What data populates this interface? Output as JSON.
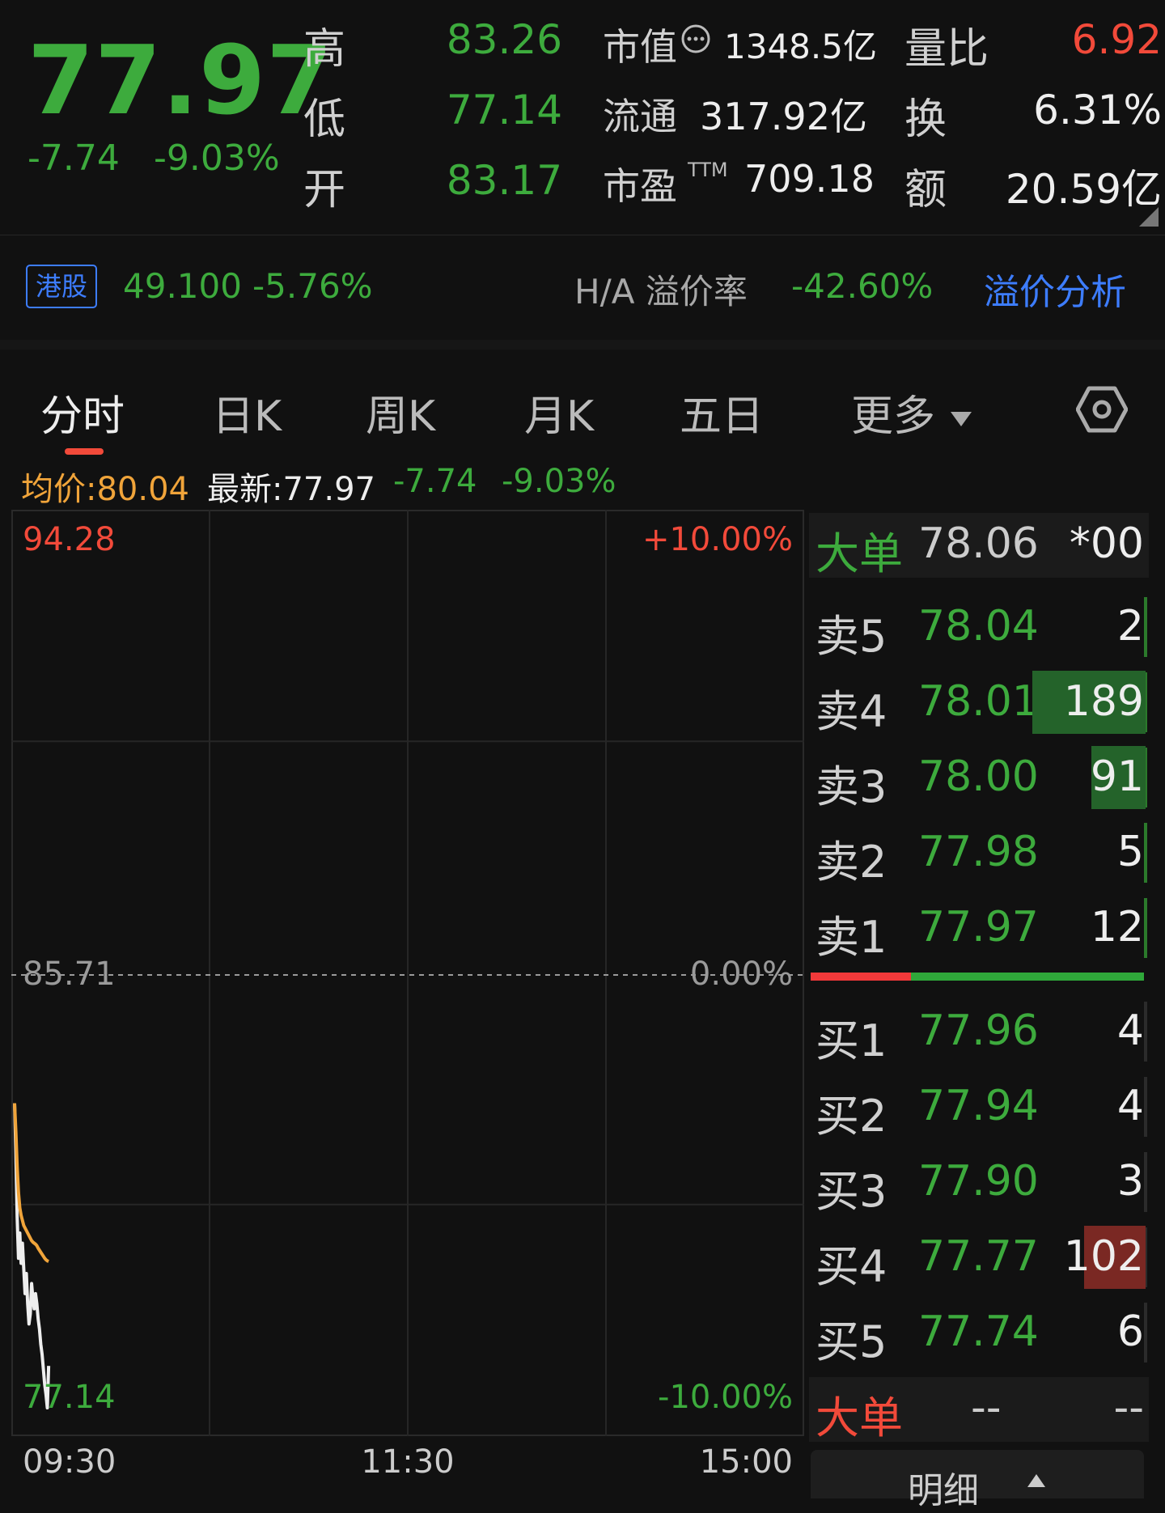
{
  "quote": {
    "price": "77.97",
    "change_abs": "-7.74",
    "change_pct": "-9.03%",
    "high_label": "高",
    "high": "83.26",
    "low_label": "低",
    "low": "77.14",
    "open_label": "开",
    "open": "83.17",
    "mcap_label": "市值",
    "mcap": "1348.5亿",
    "float_label": "流通",
    "float": "317.92亿",
    "pe_label": "市盈",
    "pe_sup": "TTM",
    "pe": "709.18",
    "vol_ratio_label": "量比",
    "vol_ratio": "6.92",
    "turnover_label": "换",
    "turnover": "6.31%",
    "amount_label": "额",
    "amount": "20.59亿"
  },
  "hk": {
    "badge": "港股",
    "price": "49.100",
    "change_pct": "-5.76%",
    "premium_label": "H/A 溢价率",
    "premium": "-42.60%",
    "analysis_link": "溢价分析"
  },
  "tabs": [
    {
      "label": "分时"
    },
    {
      "label": "日K"
    },
    {
      "label": "周K"
    },
    {
      "label": "月K"
    },
    {
      "label": "五日"
    },
    {
      "label": "更多"
    }
  ],
  "info_line": {
    "avg_label": "均价:80.04",
    "latest_label": "最新:77.97",
    "change_abs": "-7.74",
    "change_pct": "-9.03%"
  },
  "chart_data": {
    "type": "line",
    "ymax_label": "94.28",
    "ymid_label": "85.71",
    "ymin_label": "77.14",
    "pct_top": "+10.00%",
    "pct_mid": "0.00%",
    "pct_bottom": "-10.00%",
    "ylim": [
      77.14,
      94.28
    ],
    "x_labels": [
      "09:30",
      "11:30",
      "15:00"
    ],
    "series": [
      {
        "name": "",
        "color": "#eeeeee",
        "x": [
          0,
          1,
          2,
          3,
          4,
          5,
          6,
          7,
          8,
          9,
          10,
          11,
          12,
          13,
          14,
          15,
          16,
          17,
          18,
          19,
          20,
          21,
          22,
          23,
          24,
          25,
          26
        ],
        "values": [
          83.17,
          82.2,
          80.9,
          80.1,
          80.6,
          80.0,
          80.4,
          79.9,
          79.4,
          79.8,
          79.2,
          78.8,
          79.0,
          79.6,
          79.3,
          79.1,
          79.4,
          79.2,
          78.9,
          78.7,
          78.4,
          78.2,
          77.9,
          77.6,
          77.4,
          77.14,
          77.97
        ]
      },
      {
        "name": "",
        "color": "#f0a43a",
        "x": [
          0,
          1,
          2,
          3,
          4,
          5,
          6,
          7,
          8,
          9,
          10,
          11,
          12,
          13,
          14,
          15,
          16,
          17,
          18,
          19,
          20,
          21,
          22,
          23,
          24,
          25,
          26
        ],
        "values": [
          83.17,
          82.6,
          81.9,
          81.4,
          81.1,
          80.95,
          80.85,
          80.75,
          80.7,
          80.65,
          80.6,
          80.55,
          80.5,
          80.45,
          80.42,
          80.4,
          80.38,
          80.35,
          80.3,
          80.26,
          80.22,
          80.18,
          80.14,
          80.1,
          80.07,
          80.05,
          80.04
        ]
      }
    ],
    "x_total_minutes": 240
  },
  "order_book": {
    "big_order_top": {
      "label": "大单",
      "price": "78.06",
      "vol": "*00"
    },
    "asks": [
      {
        "label": "卖5",
        "price": "78.04",
        "vol": "2",
        "bar_fraction": 0.0
      },
      {
        "label": "卖4",
        "price": "78.01",
        "vol": "189",
        "bar_fraction": 1.0
      },
      {
        "label": "卖3",
        "price": "78.00",
        "vol": "91",
        "bar_fraction": 0.48
      },
      {
        "label": "卖2",
        "price": "77.98",
        "vol": "5",
        "bar_fraction": 0.0
      },
      {
        "label": "卖1",
        "price": "77.97",
        "vol": "12",
        "bar_fraction": 0.0
      }
    ],
    "bids": [
      {
        "label": "买1",
        "price": "77.96",
        "vol": "4",
        "bar_fraction": 0.0
      },
      {
        "label": "买2",
        "price": "77.94",
        "vol": "4",
        "bar_fraction": 0.0
      },
      {
        "label": "买3",
        "price": "77.90",
        "vol": "3",
        "bar_fraction": 0.0
      },
      {
        "label": "买4",
        "price": "77.77",
        "vol": "102",
        "bar_fraction": 0.54
      },
      {
        "label": "买5",
        "price": "77.74",
        "vol": "6",
        "bar_fraction": 0.0
      }
    ],
    "big_order_bottom": {
      "label": "大单",
      "price": "--",
      "vol": "--"
    },
    "detail_label": "明细",
    "buy_sell_ratio": 0.3,
    "colors": {
      "ask_bar": "#24632a",
      "bid_bar": "#7a2823",
      "split_red": "#f2393a",
      "split_green": "#2fa83a"
    }
  }
}
